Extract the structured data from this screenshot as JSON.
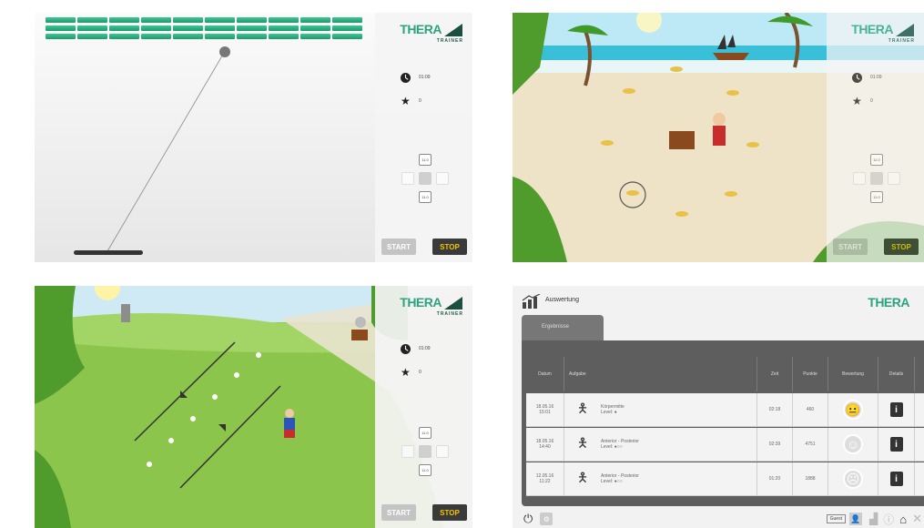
{
  "brand": {
    "name": "THERA",
    "sub": "TRAINER"
  },
  "screens": [
    {
      "time": "01:09",
      "score": "0",
      "up": "11.0",
      "down": "11.0",
      "start": "START",
      "stop": "STOP"
    },
    {
      "time": "01:09",
      "score": "0",
      "up": "11.0",
      "down": "11.0",
      "start": "START",
      "stop": "STOP"
    },
    {
      "time": "01:09",
      "score": "0",
      "up": "11.0",
      "down": "11.0",
      "start": "START",
      "stop": "STOP"
    }
  ],
  "results": {
    "title": "Auswertung",
    "tab": "Ergebnisse",
    "headers": [
      "Datum",
      "Aufgabe",
      "Zeit",
      "Punkte",
      "Bewertung",
      "Details"
    ],
    "rows": [
      {
        "date": "18.05.16",
        "time_of_day": "15:01",
        "task": "Körpermitte",
        "level": "Level: ●",
        "duration": "02:18",
        "points": "460"
      },
      {
        "date": "18.05.16",
        "time_of_day": "14:40",
        "task": "Anterior - Posterior",
        "level": "Level: ●○○",
        "duration": "02:39",
        "points": "4751"
      },
      {
        "date": "12.05.16",
        "time_of_day": "11:22",
        "task": "Anterior - Posterior",
        "level": "Level: ●○○",
        "duration": "01:20",
        "points": "1888"
      }
    ],
    "guest": "Guest"
  },
  "colors": {
    "brand": "#2aa37f",
    "stop_text": "#f3c300",
    "table_bg": "#5e5e5e"
  }
}
